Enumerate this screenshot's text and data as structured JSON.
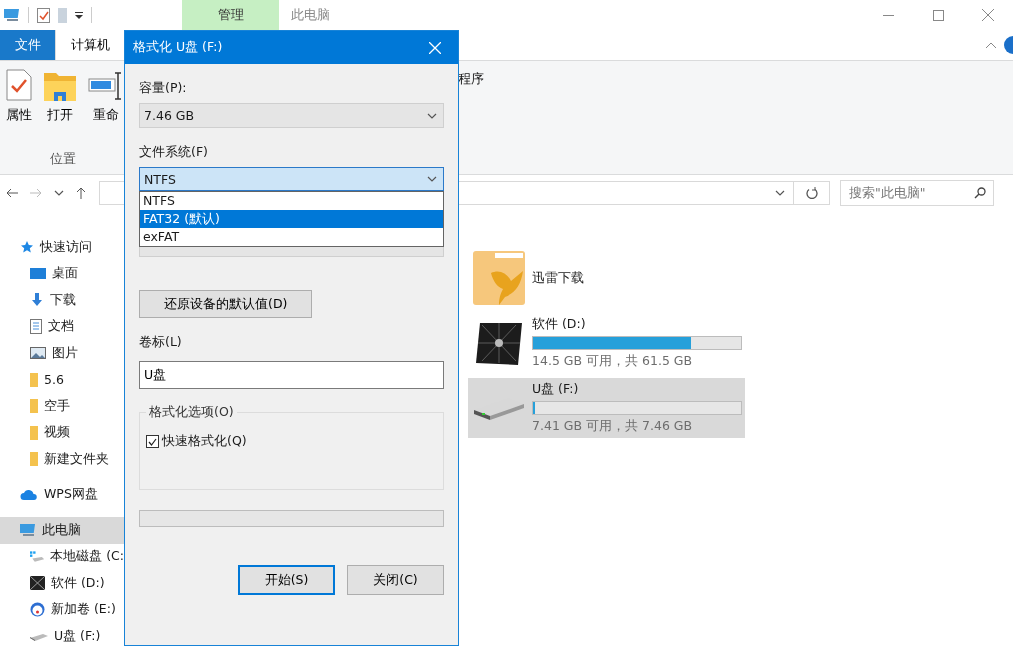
{
  "title_bar": {
    "context_tab": "管理",
    "title": "此电脑"
  },
  "ribbon": {
    "tabs": [
      {
        "label": "文件",
        "kind": "file",
        "selected": false
      },
      {
        "label": "计算机",
        "kind": "tab",
        "selected": true
      }
    ],
    "items": [
      {
        "label": "属性",
        "kind": "properties"
      },
      {
        "label": "打开",
        "kind": "open"
      },
      {
        "label": "重命",
        "kind": "rename"
      }
    ],
    "group": "位置",
    "trailing": "程序"
  },
  "search": {
    "placeholder": "搜索\"此电脑\""
  },
  "sidebar": {
    "items": [
      {
        "label": "快速访问",
        "kind": "star",
        "selected": false,
        "children": [
          {
            "label": "桌面",
            "kind": "desktop",
            "selected": false
          },
          {
            "label": "下载",
            "kind": "download",
            "selected": false
          },
          {
            "label": "文档",
            "kind": "document",
            "selected": false
          },
          {
            "label": "图片",
            "kind": "pictures",
            "selected": false
          },
          {
            "label": "5.6",
            "kind": "folder",
            "selected": false
          },
          {
            "label": "空手",
            "kind": "folder",
            "selected": false
          },
          {
            "label": "视频",
            "kind": "folder",
            "selected": false
          },
          {
            "label": "新建文件夹",
            "kind": "folder",
            "selected": false
          }
        ]
      },
      {
        "label": "WPS网盘",
        "kind": "cloud",
        "selected": false
      },
      {
        "label": "此电脑",
        "kind": "pc",
        "selected": true,
        "children": [
          {
            "label": "本地磁盘 (C:",
            "kind": "drive_c",
            "selected": false
          },
          {
            "label": "软件 (D:)",
            "kind": "drive_d",
            "selected": false
          },
          {
            "label": "新加卷 (E:)",
            "kind": "drive_e",
            "selected": false
          },
          {
            "label": "U盘 (F:)",
            "kind": "usb",
            "selected": false
          }
        ]
      }
    ]
  },
  "content": {
    "items": [
      {
        "kind": "folder",
        "name": "迅雷下载",
        "selected": false
      },
      {
        "kind": "drive",
        "name": "软件 (D:)",
        "level": 0.76,
        "reading": "14.5 GB 可用，共 61.5 GB",
        "selected": false
      },
      {
        "kind": "usb",
        "name": "U盘 (F:)",
        "level": 0.01,
        "reading": "7.41 GB 可用，共 7.46 GB",
        "selected": true
      }
    ]
  },
  "dialog": {
    "title": "格式化 U盘 (F:)",
    "capacity_label": "容量(P):",
    "capacity": "7.46 GB",
    "filesystem_label": "文件系统(F)",
    "filesystem": "NTFS",
    "filesystem_options": [
      {
        "label": "NTFS",
        "selected": false
      },
      {
        "label": "FAT32 (默认)",
        "selected": true
      },
      {
        "label": "exFAT",
        "selected": false
      }
    ],
    "restore_button": "还原设备的默认值(D)",
    "volume_label_label": "卷标(L)",
    "volume_label": "U盘",
    "options_group": "格式化选项(O)",
    "quick_format": {
      "label": "快速格式化(Q)",
      "checked": true
    },
    "progress": {
      "level": 0
    },
    "buttons": [
      {
        "label": "开始(S)",
        "default": true
      },
      {
        "label": "关闭(C)",
        "default": false
      }
    ]
  }
}
